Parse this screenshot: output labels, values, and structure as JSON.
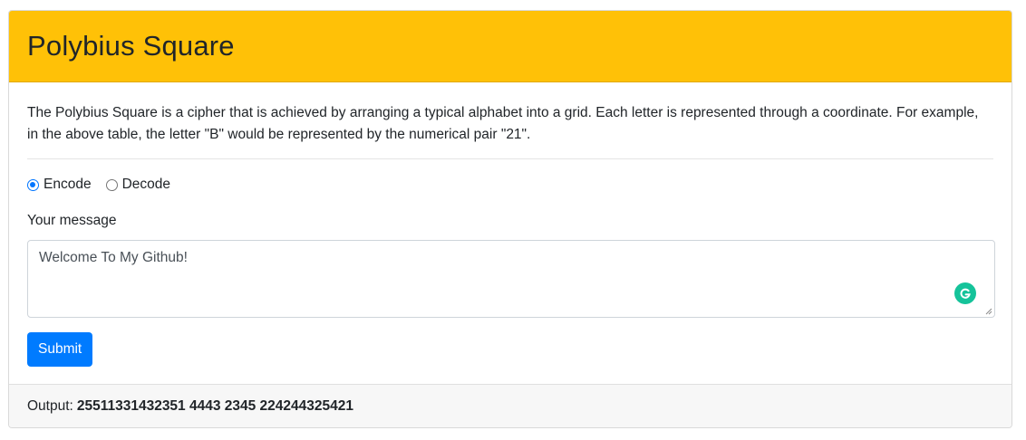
{
  "header": {
    "title": "Polybius Square"
  },
  "description": "The Polybius Square is a cipher that is achieved by arranging a typical alphabet into a grid. Each letter is represented through a coordinate. For example, in the above table, the letter \"B\" would be represented by the numerical pair \"21\".",
  "mode": {
    "options": [
      {
        "label": "Encode",
        "selected": true
      },
      {
        "label": "Decode",
        "selected": false
      }
    ]
  },
  "message": {
    "label": "Your message",
    "value": "Welcome To My Github!"
  },
  "submit": {
    "label": "Submit"
  },
  "output": {
    "label": "Output:",
    "value": "25511331432351 4443 2345 224244325421"
  },
  "colors": {
    "header_bg": "#ffc107",
    "primary": "#007bff",
    "radio_accent": "#0075ff",
    "grammarly": "#15c39a",
    "footer_bg": "#f7f7f7"
  },
  "icons": {
    "grammarly": "grammarly-icon",
    "resize": "resize-grip-icon"
  }
}
